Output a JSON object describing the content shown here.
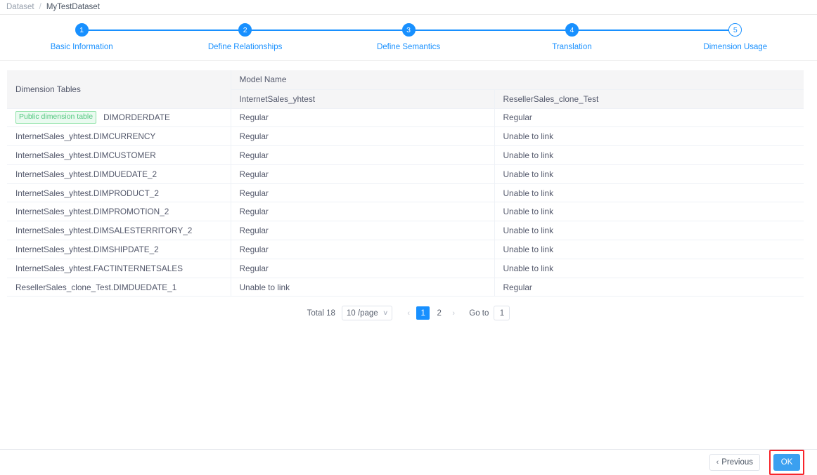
{
  "breadcrumb": {
    "root": "Dataset",
    "separator": "/",
    "current": "MyTestDataset"
  },
  "stepper": {
    "steps": [
      {
        "num": "1",
        "label": "Basic Information"
      },
      {
        "num": "2",
        "label": "Define Relationships"
      },
      {
        "num": "3",
        "label": "Define Semantics"
      },
      {
        "num": "4",
        "label": "Translation"
      },
      {
        "num": "5",
        "label": "Dimension Usage"
      }
    ],
    "active_index": 4
  },
  "table": {
    "dimension_header": "Dimension Tables",
    "group_header": "Model Name",
    "model_columns": [
      "InternetSales_yhtest",
      "ResellerSales_clone_Test"
    ],
    "public_tag": "Public dimension table",
    "rows": [
      {
        "tag": "Public dimension table",
        "name": "DIMORDERDATE",
        "model1": "Regular",
        "model2": "Regular"
      },
      {
        "tag": "",
        "name": "InternetSales_yhtest.DIMCURRENCY",
        "model1": "Regular",
        "model2": "Unable to link"
      },
      {
        "tag": "",
        "name": "InternetSales_yhtest.DIMCUSTOMER",
        "model1": "Regular",
        "model2": "Unable to link"
      },
      {
        "tag": "",
        "name": "InternetSales_yhtest.DIMDUEDATE_2",
        "model1": "Regular",
        "model2": "Unable to link"
      },
      {
        "tag": "",
        "name": "InternetSales_yhtest.DIMPRODUCT_2",
        "model1": "Regular",
        "model2": "Unable to link"
      },
      {
        "tag": "",
        "name": "InternetSales_yhtest.DIMPROMOTION_2",
        "model1": "Regular",
        "model2": "Unable to link"
      },
      {
        "tag": "",
        "name": "InternetSales_yhtest.DIMSALESTERRITORY_2",
        "model1": "Regular",
        "model2": "Unable to link"
      },
      {
        "tag": "",
        "name": "InternetSales_yhtest.DIMSHIPDATE_2",
        "model1": "Regular",
        "model2": "Unable to link"
      },
      {
        "tag": "",
        "name": "InternetSales_yhtest.FACTINTERNETSALES",
        "model1": "Regular",
        "model2": "Unable to link"
      },
      {
        "tag": "",
        "name": "ResellerSales_clone_Test.DIMDUEDATE_1",
        "model1": "Unable to link",
        "model2": "Regular"
      }
    ]
  },
  "pagination": {
    "total": "Total 18",
    "page_size": "10 /page",
    "prev_arrow": "‹",
    "next_arrow": "›",
    "caret": "∨",
    "pages": [
      "1",
      "2"
    ],
    "current_page": "1",
    "goto_label": "Go to",
    "goto_value": "1"
  },
  "footer": {
    "previous_label": "Previous",
    "previous_icon": "‹",
    "ok_label": "OK"
  },
  "colors": {
    "accent": "#1890ff",
    "ok_button": "#3ba0f0",
    "highlight_box": "#f8242a",
    "tag_green_text": "#52c77f",
    "tag_green_bg": "#eafaf0"
  }
}
